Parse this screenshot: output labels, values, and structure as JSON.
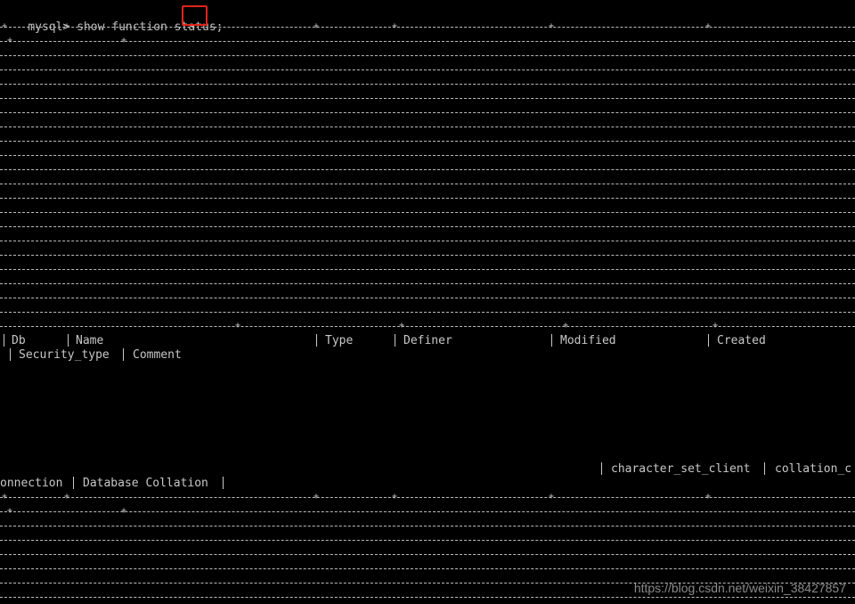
{
  "terminal": {
    "prompt": "mysql>",
    "command": "show function status;"
  },
  "table": {
    "headers_row1": [
      "Db",
      "Name",
      "Type",
      "Definer",
      "Modified",
      "Created"
    ],
    "headers_row2": [
      "Security_type",
      "Comment"
    ],
    "headers_row3": [
      "character_set_client",
      "collation_c"
    ],
    "headers_row4": [
      "onnection",
      "Database Collation"
    ]
  },
  "watermark": {
    "text": "https://blog.csdn.net/weixin_38427857"
  },
  "colors": {
    "background": "#000000",
    "text": "#c0c0c0",
    "highlight": "#e0241b"
  }
}
